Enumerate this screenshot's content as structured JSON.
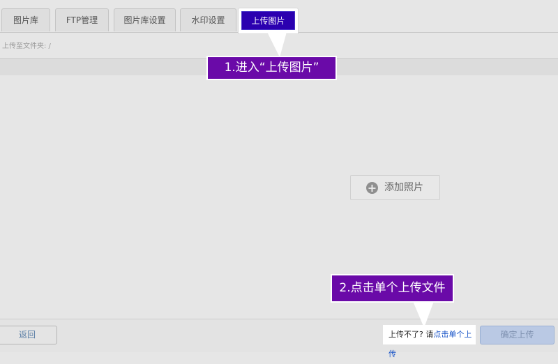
{
  "tabs": [
    {
      "label": "图片库"
    },
    {
      "label": "FTP管理"
    },
    {
      "label": "图片库设置"
    },
    {
      "label": "水印设置"
    },
    {
      "label": "上传图片"
    }
  ],
  "path": {
    "label": "上传至文件夹: /"
  },
  "add_photo": {
    "label": "添加照片",
    "icon": "plus-circle-icon"
  },
  "footer": {
    "back_label": "返回",
    "help_prefix": "上传不了? 请",
    "help_link": "点击单个上传",
    "confirm_label": "确定上传"
  },
  "callouts": {
    "step1": "1.进入“上传图片”",
    "step2": "2.点击单个上传文件"
  },
  "colors": {
    "active_tab": "#2b00b0",
    "callout": "#6a0aa8",
    "link": "#1a55c8",
    "confirm_button": "#bac9e4"
  }
}
